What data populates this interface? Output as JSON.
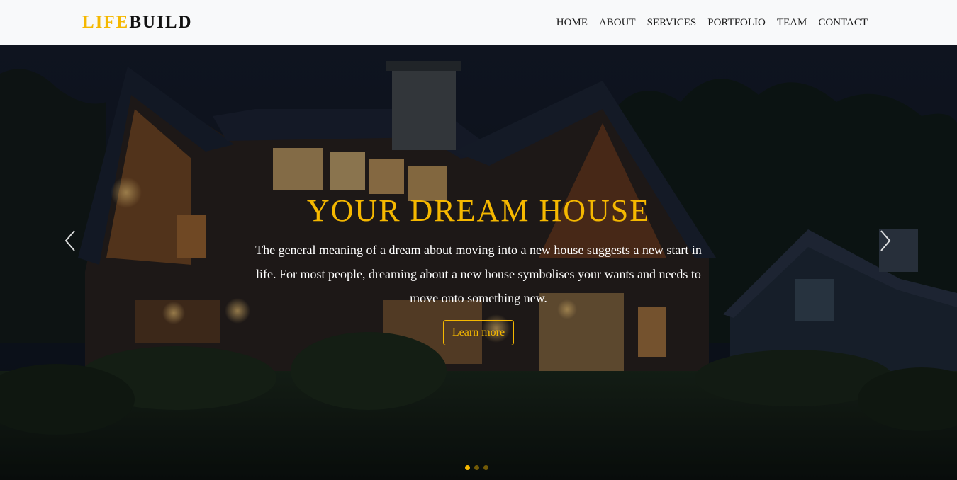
{
  "brand": {
    "part1": "LIFE",
    "part2": "BUILD"
  },
  "nav": {
    "items": [
      {
        "label": "HOME"
      },
      {
        "label": "ABOUT"
      },
      {
        "label": "SERVICES"
      },
      {
        "label": "PORTFOLIO"
      },
      {
        "label": "TEAM"
      },
      {
        "label": "CONTACT"
      }
    ]
  },
  "hero": {
    "title": "YOUR DREAM HOUSE",
    "description": "The general meaning of a dream about moving into a new house suggests a new start in life. For most people, dreaming about a new house symbolises your wants and needs to move onto something new.",
    "button_label": "Learn more",
    "prev_icon": "chevron-left-icon",
    "next_icon": "chevron-right-icon",
    "slides_count": 3,
    "active_slide": 1
  },
  "colors": {
    "accent": "#f5b800",
    "navbar_bg": "#f8f9fa",
    "nav_text": "#1a1a1a",
    "caption_text": "#ffffff"
  }
}
